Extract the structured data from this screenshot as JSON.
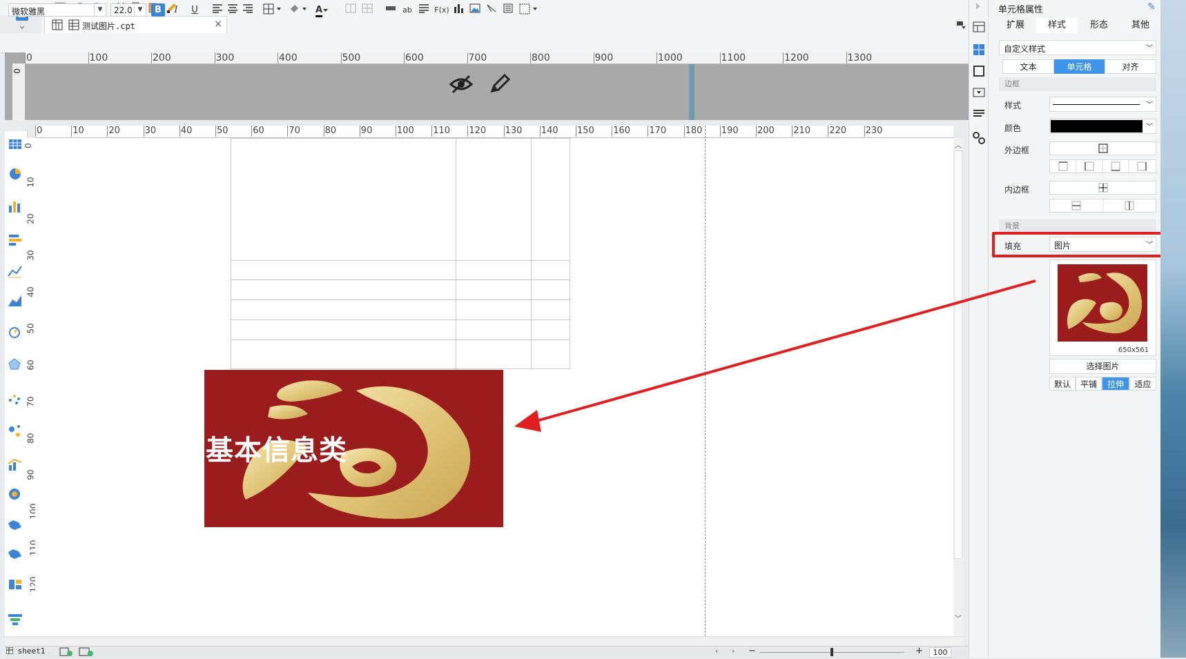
{
  "tab": {
    "file_name": "测试图片.cpt",
    "close": "×"
  },
  "format_bar": {
    "font_family": "微软雅黑",
    "font_size": "22.0",
    "bold": "B",
    "italic": "I",
    "underline": "U",
    "font_color_glyph": "A",
    "fx": "F(x)",
    "ab": "ab"
  },
  "top_ruler": {
    "labels": [
      "0",
      "100",
      "200",
      "300",
      "400",
      "500",
      "600",
      "700",
      "800",
      "900",
      "1000",
      "1100",
      "1200",
      "1300"
    ]
  },
  "top_ruler_left": "0",
  "main_ruler": {
    "labels": [
      "0",
      "10",
      "20",
      "30",
      "40",
      "50",
      "60",
      "70",
      "80",
      "90",
      "100",
      "110",
      "120",
      "130",
      "140",
      "150",
      "160",
      "170",
      "180",
      "190",
      "200",
      "210",
      "220",
      "230"
    ]
  },
  "v_ruler": {
    "labels": [
      "0",
      "10",
      "20",
      "30",
      "40",
      "50",
      "60",
      "70",
      "80",
      "90",
      "100",
      "110",
      "120"
    ]
  },
  "image_cell": {
    "caption": "基本信息类"
  },
  "status": {
    "sheet_name": "sheet1",
    "zoom": "100",
    "minus": "−",
    "plus": "+"
  },
  "panel": {
    "title": "单元格属性",
    "tabs": [
      "扩展",
      "样式",
      "形态",
      "其他"
    ],
    "active_tab": 1,
    "style_select": "自定义样式",
    "segments": [
      "文本",
      "单元格",
      "对齐"
    ],
    "active_segment": 1,
    "border_section": "边框",
    "style_label": "样式",
    "color_label": "颜色",
    "color_value": "#000000",
    "outer_border_label": "外边框",
    "inner_border_label": "内边框",
    "background_section": "背景",
    "fill_label": "填充",
    "fill_value": "图片",
    "image_size": "650x561",
    "choose_image": "选择图片",
    "fit_options": [
      "默认",
      "平铺",
      "拉伸",
      "适应"
    ],
    "active_fit": 2
  },
  "colors": {
    "accent": "#3d94e8",
    "highlight": "#e02020",
    "image_bg": "#9b1c1c",
    "gold": "#e8d28a"
  }
}
